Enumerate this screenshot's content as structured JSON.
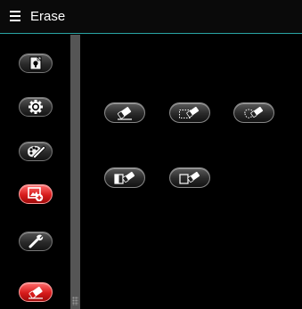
{
  "header": {
    "title": "Erase",
    "menu_icon": "hamburger-menu-icon"
  },
  "sidebar": {
    "items": [
      {
        "name": "tips",
        "icon": "lightbulb-page-icon",
        "active": false
      },
      {
        "name": "settings",
        "icon": "gear-icon",
        "active": false
      },
      {
        "name": "paint",
        "icon": "palette-brush-icon",
        "active": false
      },
      {
        "name": "add-image",
        "icon": "image-add-icon",
        "active": false,
        "color": "#d71b1b"
      },
      {
        "name": "tools",
        "icon": "wrench-icon",
        "active": false
      },
      {
        "name": "erase",
        "icon": "eraser-icon",
        "active": true,
        "color": "#d71b1b"
      }
    ]
  },
  "tools": [
    {
      "name": "eraser",
      "icon": "eraser-icon"
    },
    {
      "name": "rect-select-erase",
      "icon": "rect-select-eraser-icon"
    },
    {
      "name": "lasso-select-erase",
      "icon": "lasso-select-eraser-icon"
    },
    {
      "name": "erase-left-half",
      "icon": "half-filled-eraser-icon"
    },
    {
      "name": "erase-outline",
      "icon": "outline-box-eraser-icon"
    }
  ],
  "colors": {
    "accent": "#2aa4a4",
    "active": "#d71b1b",
    "background": "#000000"
  }
}
